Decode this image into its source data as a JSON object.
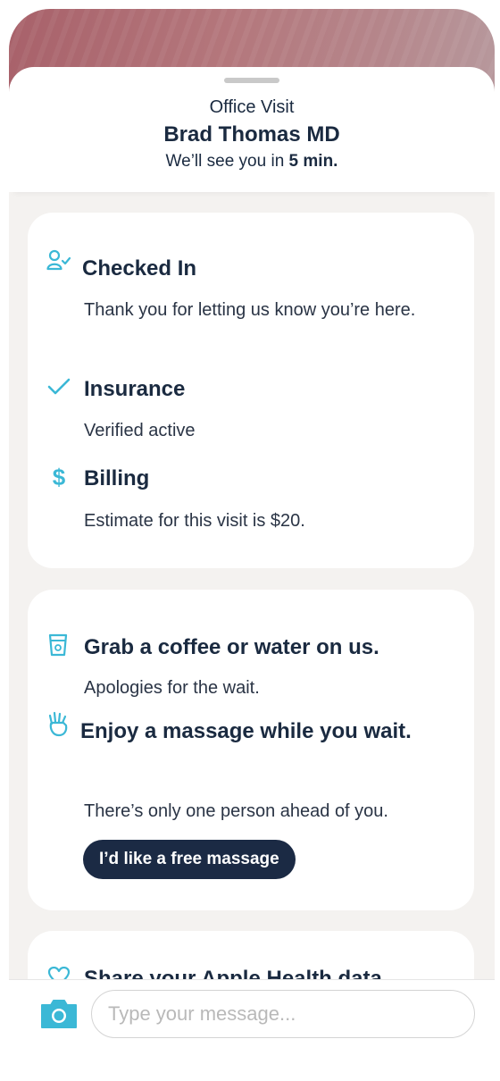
{
  "header": {
    "visit_type": "Office Visit",
    "doctor_name": "Brad Thomas MD",
    "wait_prefix": "We’ll see you in ",
    "wait_time": "5 min."
  },
  "status_card": {
    "items": [
      {
        "icon": "person-check-icon",
        "title": "Checked In",
        "body": "Thank you for letting us know you’re here."
      },
      {
        "icon": "checkmark-icon",
        "title": "Insurance",
        "body": "Verified active"
      },
      {
        "icon": "dollar-icon",
        "title": "Billing",
        "body": "Estimate for this visit is $20."
      }
    ]
  },
  "amenities_card": {
    "coffee": {
      "icon": "cup-icon",
      "title": "Grab a coffee or water on us.",
      "body": "Apologies for the wait."
    },
    "massage": {
      "icon": "hand-icon",
      "title": "Enjoy a massage while you wait.",
      "body": "There’s only one person ahead of you.",
      "button_label": "I’d like a free massage"
    }
  },
  "health_card": {
    "icon": "heart-icon",
    "title": "Share your Apple Health data"
  },
  "composer": {
    "camera_icon": "camera-icon",
    "placeholder": "Type your message..."
  },
  "colors": {
    "accent": "#3bb8d6",
    "navy": "#1b2a44",
    "hero": "#a8616a",
    "background": "#f4f2f0"
  }
}
